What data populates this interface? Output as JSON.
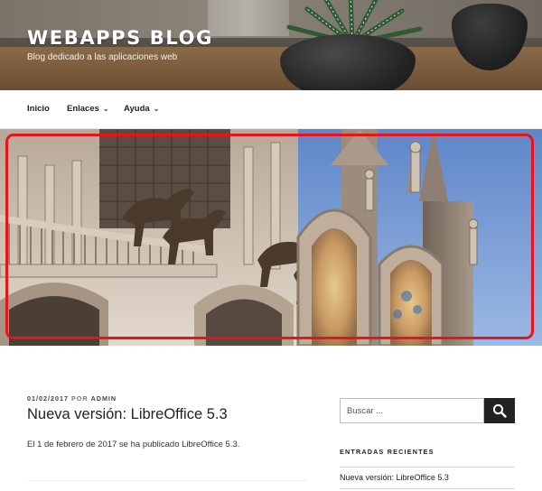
{
  "site": {
    "title": "WEBAPPS BLOG",
    "tagline": "Blog dedicado a las aplicaciones web"
  },
  "nav": {
    "items": [
      {
        "label": "Inicio",
        "has_submenu": false
      },
      {
        "label": "Enlaces",
        "has_submenu": true
      },
      {
        "label": "Ayuda",
        "has_submenu": true
      }
    ],
    "submenu_icon": "chevron-down-icon"
  },
  "banner": {
    "image": "venice-basilica-horses-photo",
    "highlight_color": "#e8141b"
  },
  "post": {
    "date": "01/02/2017",
    "by": "POR",
    "author": "ADMIN",
    "title": "Nueva versión: LibreOffice 5.3",
    "excerpt": "El 1 de febrero de 2017 se ha publicado LibreOffice 5.3."
  },
  "sidebar": {
    "search": {
      "placeholder": "Buscar ...",
      "button_icon": "search-icon"
    },
    "recent_title": "ENTRADAS RECIENTES",
    "recent_items": [
      "Nueva versión: LibreOffice 5.3"
    ]
  },
  "colors": {
    "text": "#222222",
    "search_button": "#222222",
    "highlight": "#e8141b"
  }
}
